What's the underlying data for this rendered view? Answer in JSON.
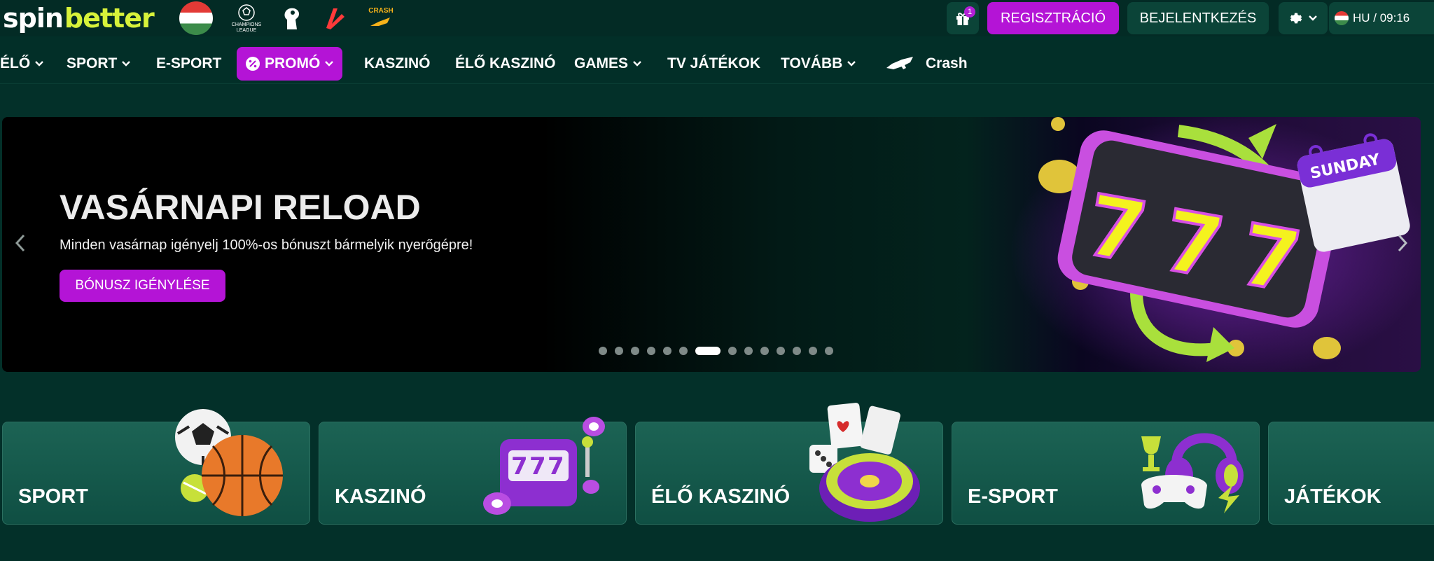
{
  "brand": {
    "logo_spin": "spin",
    "logo_better": "better"
  },
  "quick_icons": [
    {
      "name": "hungary-flag-icon"
    },
    {
      "name": "champions-league-icon",
      "caption": "CHAMPIONS LEAGUE"
    },
    {
      "name": "premier-league-icon"
    },
    {
      "name": "laliga-icon"
    },
    {
      "name": "crash-icon",
      "caption": "CRASH"
    }
  ],
  "header": {
    "gift_badge": "1",
    "register_label": "REGISZTRÁCIÓ",
    "login_label": "BEJELENTKEZÉS",
    "lang_time": "HU / 09:16"
  },
  "nav": {
    "items": [
      {
        "label": "ÉLŐ"
      },
      {
        "label": "SPORT"
      },
      {
        "label": "E-SPORT"
      },
      {
        "label": "PROMÓ"
      },
      {
        "label": "KASZINÓ"
      },
      {
        "label": "ÉLŐ KASZINÓ"
      },
      {
        "label": "GAMES"
      },
      {
        "label": "TV JÁTÉKOK"
      },
      {
        "label": "TOVÁBB"
      },
      {
        "label": "Crash"
      }
    ]
  },
  "banner": {
    "title": "VASÁRNAPI RELOAD",
    "subtitle": "Minden vasárnap igényelj 100%-os bónuszt bármelyik nyerőgépre!",
    "button_label": "BÓNUSZ IGÉNYLÉSE",
    "art_label": "SUNDAY",
    "slide_count": 14,
    "active_slide": 7
  },
  "categories": [
    {
      "label": "SPORT"
    },
    {
      "label": "KASZINÓ"
    },
    {
      "label": "ÉLŐ KASZINÓ"
    },
    {
      "label": "E-SPORT"
    },
    {
      "label": "JÁTÉKOK"
    }
  ],
  "colors": {
    "background": "#033029",
    "accent_purple": "#b414d6",
    "brand_lime": "#d7f23a",
    "card": "#1c6354"
  }
}
